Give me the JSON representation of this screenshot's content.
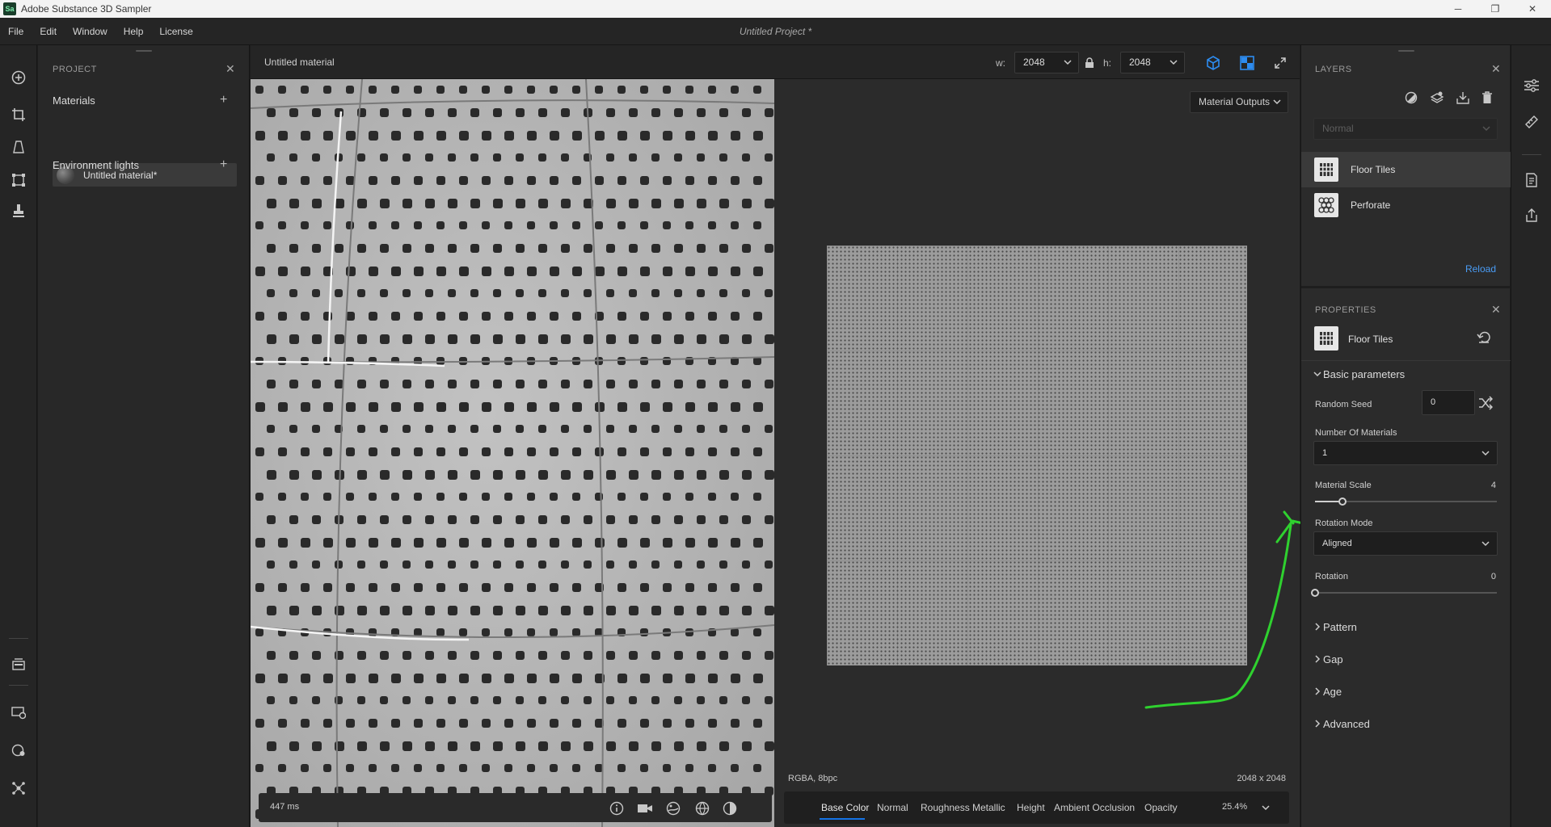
{
  "window": {
    "logo": "Sa",
    "title": "Adobe Substance 3D Sampler",
    "minimize": "─",
    "restore": "❐",
    "close": "✕"
  },
  "menu": {
    "items": [
      "File",
      "Edit",
      "Window",
      "Help",
      "License"
    ],
    "project_title": "Untitled Project *"
  },
  "left_toolbar": {
    "icons": [
      "add-circle-icon",
      "crop-icon",
      "perspective-icon",
      "transform-icon",
      "stamp-icon",
      "asset-library-icon",
      "render-icon",
      "material-ball-icon",
      "network-icon"
    ]
  },
  "project_panel": {
    "title": "PROJECT",
    "close": "✕",
    "materials_label": "Materials",
    "add": "+",
    "material_name": "Untitled material*",
    "env_lights_label": "Environment lights"
  },
  "viewport_header": {
    "tab_label": "Untitled material",
    "width_label": "w:",
    "width_value": "2048",
    "height_label": "h:",
    "height_value": "2048",
    "chevron": "⌄",
    "lock_icon": "lock-icon"
  },
  "viewport_3d": {
    "render_time": "447 ms"
  },
  "viewport_2d": {
    "outputs_label": "Material Outputs",
    "format": "RGBA, 8bpc",
    "size": "2048 x 2048",
    "channels": [
      "Base Color",
      "Normal",
      "Roughness",
      "Metallic",
      "Height",
      "Ambient Occlusion",
      "Opacity"
    ],
    "active_channel": "Base Color",
    "zoom": "25.4%"
  },
  "layers": {
    "title": "LAYERS",
    "close": "✕",
    "blend_mode": "Normal",
    "items": [
      {
        "name": "Floor Tiles",
        "selected": true
      },
      {
        "name": "Perforate",
        "selected": false
      }
    ],
    "reload": "Reload"
  },
  "properties": {
    "title": "PROPERTIES",
    "close": "✕",
    "layer_name": "Floor Tiles",
    "basic_group": "Basic parameters",
    "random_seed_label": "Random Seed",
    "random_seed_value": "0",
    "num_materials_label": "Number Of Materials",
    "num_materials_value": "1",
    "material_scale_label": "Material Scale",
    "material_scale_value": "4",
    "material_scale_fraction": 0.15,
    "rotation_mode_label": "Rotation Mode",
    "rotation_mode_value": "Aligned",
    "rotation_label": "Rotation",
    "rotation_value": "0",
    "rotation_fraction": 0.0,
    "groups": [
      "Pattern",
      "Gap",
      "Age",
      "Advanced"
    ]
  },
  "colors": {
    "accent": "#1473e6",
    "link": "#4a9cf5",
    "annotation": "#2fd12f"
  }
}
